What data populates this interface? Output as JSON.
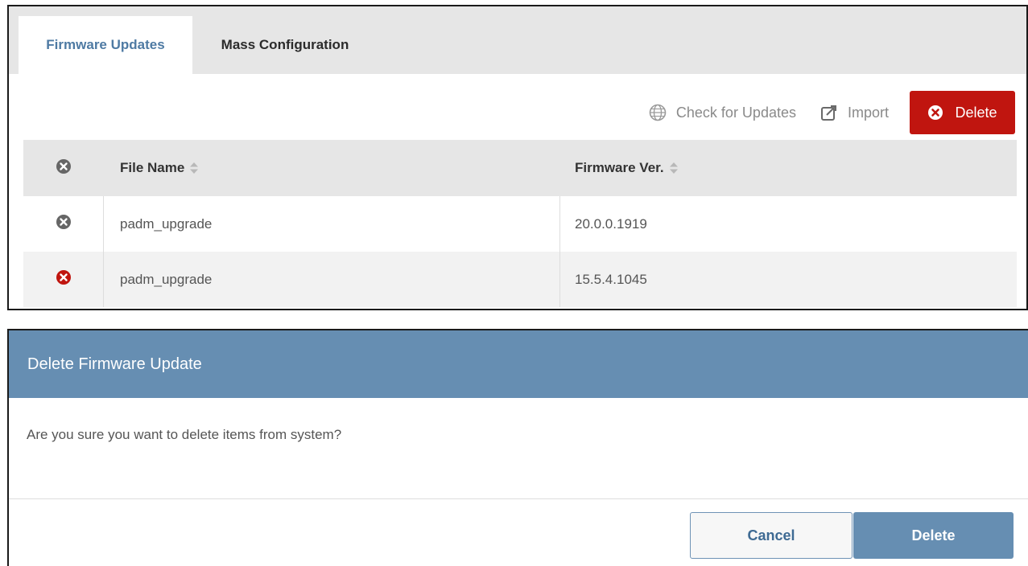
{
  "tabs": [
    {
      "label": "Firmware Updates",
      "active": true
    },
    {
      "label": "Mass Configuration",
      "active": false
    }
  ],
  "toolbar": {
    "check_label": "Check for Updates",
    "import_label": "Import",
    "delete_label": "Delete"
  },
  "table": {
    "columns": {
      "file_name": "File Name",
      "firmware_ver": "Firmware Ver."
    },
    "rows": [
      {
        "file_name": "padm_upgrade",
        "firmware_ver": "20.0.0.1919",
        "selected": false
      },
      {
        "file_name": "padm_upgrade",
        "firmware_ver": "15.5.4.1045",
        "selected": true
      }
    ]
  },
  "dialog": {
    "title": "Delete Firmware Update",
    "message": "Are you sure you want to delete items from system?",
    "cancel_label": "Cancel",
    "confirm_label": "Delete"
  },
  "icons": {
    "check": "globe-icon",
    "import": "import-icon",
    "remove": "remove-circle-icon",
    "sort": "sort-icon"
  },
  "colors": {
    "primary": "#668eb2",
    "active_tab_text": "#4e7aa3",
    "danger": "#c0150f",
    "icon_gray": "#555555",
    "muted_text": "#8a8a8a"
  }
}
